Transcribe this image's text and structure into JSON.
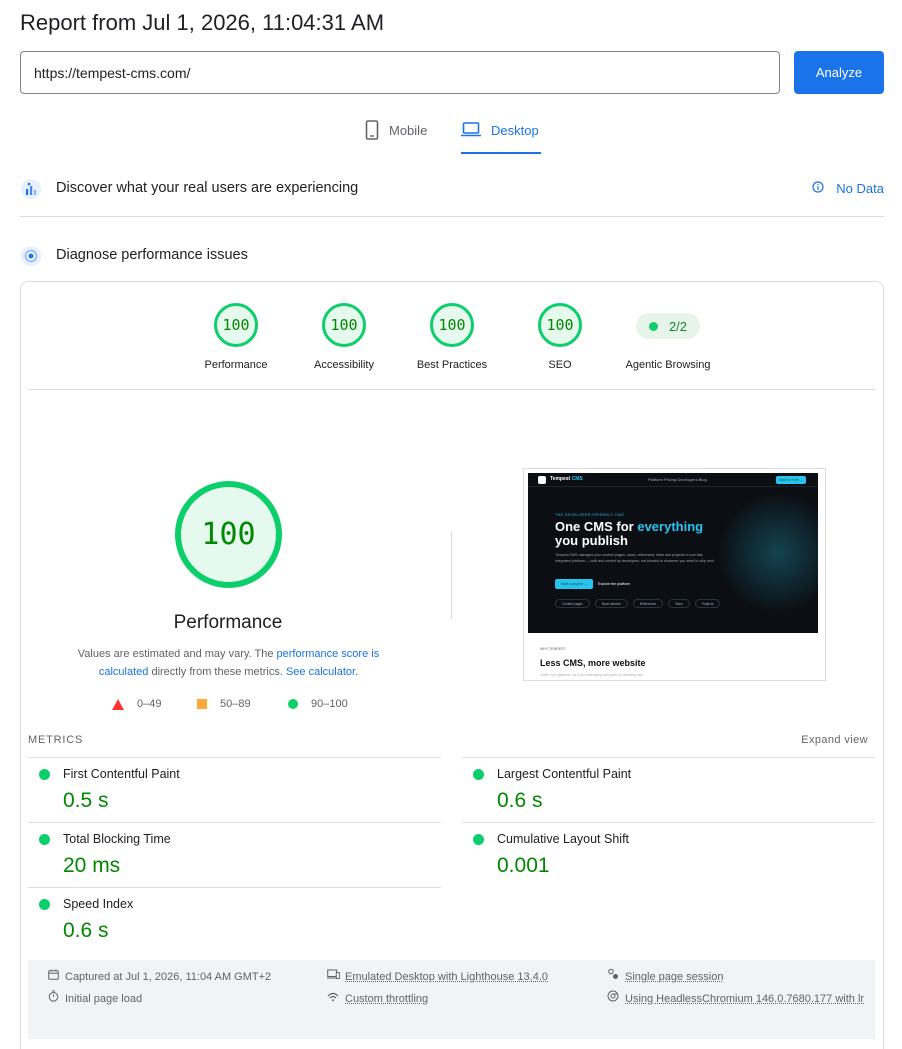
{
  "header": {
    "title": "Report from Jul 1, 2026, 11:04:31 AM"
  },
  "url_input": {
    "value": "https://tempest-cms.com/"
  },
  "analyze_label": "Analyze",
  "tabs": [
    {
      "label": "Mobile",
      "icon": "smartphone-icon",
      "active": false
    },
    {
      "label": "Desktop",
      "icon": "laptop-icon",
      "active": true
    }
  ],
  "crux": {
    "label": "Discover what your real users are experiencing",
    "no_data": "No Data"
  },
  "diagnose": {
    "label": "Diagnose performance issues"
  },
  "scores": [
    {
      "label": "Performance",
      "value": "100"
    },
    {
      "label": "Accessibility",
      "value": "100"
    },
    {
      "label": "Best Practices",
      "value": "100"
    },
    {
      "label": "SEO",
      "value": "100"
    }
  ],
  "agentic": {
    "label": "Agentic Browsing",
    "value": "2/2"
  },
  "main_score": {
    "value": "100",
    "label": "Performance",
    "explain_prefix": "Values are estimated and may vary. The ",
    "explain_link1": "performance score is calculated",
    "explain_mid": " directly from these metrics. ",
    "explain_link2": "See calculator",
    "explain_suffix": "."
  },
  "legend": [
    {
      "range": "0–49",
      "color": "#ff3333",
      "shape": "triangle"
    },
    {
      "range": "50–89",
      "color": "#ffaa33",
      "shape": "square"
    },
    {
      "range": "90–100",
      "color": "#0cce6b",
      "shape": "circle"
    }
  ],
  "screenshot": {
    "logo": "Tempest",
    "logo_accent": "CMS",
    "nav_links": "Platform    Pricing    Developers    Blog",
    "cta": "Start for free →",
    "kicker": "THE DEVELOPER-FRIENDLY CMS",
    "headline_a": "One CMS for ",
    "headline_accent": "everything",
    "headline_b": "you publish",
    "body": "Tempest CMS manages your content pages, news, references, team and projects in one fast, integrated platform — built and owned by developers, not bloated to whatever you need to ship next.",
    "btn_primary": "Start a project →",
    "btn_secondary": "Explore the platform",
    "chips": [
      "Content pages",
      "News articles",
      "References",
      "Team",
      "Projects"
    ],
    "section_kicker": "WHY TEMPEST",
    "section_title": "Less CMS, more website",
    "section_faint": "Other Your platform, for is for everything and work on directing tool"
  },
  "metrics_section": {
    "title": "METRICS",
    "expand": "Expand view"
  },
  "metrics": [
    {
      "name": "First Contentful Paint",
      "value": "0.5 s",
      "status": "good"
    },
    {
      "name": "Largest Contentful Paint",
      "value": "0.6 s",
      "status": "good"
    },
    {
      "name": "Total Blocking Time",
      "value": "20 ms",
      "status": "good"
    },
    {
      "name": "Cumulative Layout Shift",
      "value": "0.001",
      "status": "good"
    },
    {
      "name": "Speed Index",
      "value": "0.6 s",
      "status": "good"
    }
  ],
  "footer": {
    "captured": "Captured at Jul 1, 2026, 11:04 AM GMT+2",
    "load": "Initial page load",
    "emulated": "Emulated Desktop with Lighthouse 13.4.0",
    "throttling": "Custom throttling",
    "session": "Single page session",
    "browser": "Using HeadlessChromium 146.0.7680.177 with lr"
  },
  "colors": {
    "accent": "#1a73e8",
    "pass": "#0cce6b",
    "pass_text": "#008800",
    "average": "#ffaa33",
    "fail": "#ff3333"
  }
}
